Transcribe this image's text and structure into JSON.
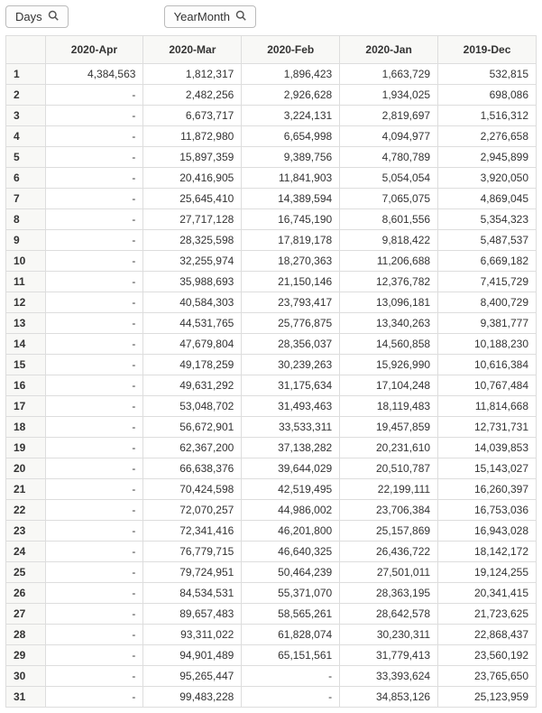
{
  "pills": {
    "days_label": "Days",
    "yearmonth_label": "YearMonth"
  },
  "table": {
    "columns": [
      "2020-Apr",
      "2020-Mar",
      "2020-Feb",
      "2020-Jan",
      "2019-Dec"
    ],
    "rows": [
      {
        "day": "1",
        "cells": [
          "4,384,563",
          "1,812,317",
          "1,896,423",
          "1,663,729",
          "532,815"
        ]
      },
      {
        "day": "2",
        "cells": [
          "-",
          "2,482,256",
          "2,926,628",
          "1,934,025",
          "698,086"
        ]
      },
      {
        "day": "3",
        "cells": [
          "-",
          "6,673,717",
          "3,224,131",
          "2,819,697",
          "1,516,312"
        ]
      },
      {
        "day": "4",
        "cells": [
          "-",
          "11,872,980",
          "6,654,998",
          "4,094,977",
          "2,276,658"
        ]
      },
      {
        "day": "5",
        "cells": [
          "-",
          "15,897,359",
          "9,389,756",
          "4,780,789",
          "2,945,899"
        ]
      },
      {
        "day": "6",
        "cells": [
          "-",
          "20,416,905",
          "11,841,903",
          "5,054,054",
          "3,920,050"
        ]
      },
      {
        "day": "7",
        "cells": [
          "-",
          "25,645,410",
          "14,389,594",
          "7,065,075",
          "4,869,045"
        ]
      },
      {
        "day": "8",
        "cells": [
          "-",
          "27,717,128",
          "16,745,190",
          "8,601,556",
          "5,354,323"
        ]
      },
      {
        "day": "9",
        "cells": [
          "-",
          "28,325,598",
          "17,819,178",
          "9,818,422",
          "5,487,537"
        ]
      },
      {
        "day": "10",
        "cells": [
          "-",
          "32,255,974",
          "18,270,363",
          "11,206,688",
          "6,669,182"
        ]
      },
      {
        "day": "11",
        "cells": [
          "-",
          "35,988,693",
          "21,150,146",
          "12,376,782",
          "7,415,729"
        ]
      },
      {
        "day": "12",
        "cells": [
          "-",
          "40,584,303",
          "23,793,417",
          "13,096,181",
          "8,400,729"
        ]
      },
      {
        "day": "13",
        "cells": [
          "-",
          "44,531,765",
          "25,776,875",
          "13,340,263",
          "9,381,777"
        ]
      },
      {
        "day": "14",
        "cells": [
          "-",
          "47,679,804",
          "28,356,037",
          "14,560,858",
          "10,188,230"
        ]
      },
      {
        "day": "15",
        "cells": [
          "-",
          "49,178,259",
          "30,239,263",
          "15,926,990",
          "10,616,384"
        ]
      },
      {
        "day": "16",
        "cells": [
          "-",
          "49,631,292",
          "31,175,634",
          "17,104,248",
          "10,767,484"
        ]
      },
      {
        "day": "17",
        "cells": [
          "-",
          "53,048,702",
          "31,493,463",
          "18,119,483",
          "11,814,668"
        ]
      },
      {
        "day": "18",
        "cells": [
          "-",
          "56,672,901",
          "33,533,311",
          "19,457,859",
          "12,731,731"
        ]
      },
      {
        "day": "19",
        "cells": [
          "-",
          "62,367,200",
          "37,138,282",
          "20,231,610",
          "14,039,853"
        ]
      },
      {
        "day": "20",
        "cells": [
          "-",
          "66,638,376",
          "39,644,029",
          "20,510,787",
          "15,143,027"
        ]
      },
      {
        "day": "21",
        "cells": [
          "-",
          "70,424,598",
          "42,519,495",
          "22,199,111",
          "16,260,397"
        ]
      },
      {
        "day": "22",
        "cells": [
          "-",
          "72,070,257",
          "44,986,002",
          "23,706,384",
          "16,753,036"
        ]
      },
      {
        "day": "23",
        "cells": [
          "-",
          "72,341,416",
          "46,201,800",
          "25,157,869",
          "16,943,028"
        ]
      },
      {
        "day": "24",
        "cells": [
          "-",
          "76,779,715",
          "46,640,325",
          "26,436,722",
          "18,142,172"
        ]
      },
      {
        "day": "25",
        "cells": [
          "-",
          "79,724,951",
          "50,464,239",
          "27,501,011",
          "19,124,255"
        ]
      },
      {
        "day": "26",
        "cells": [
          "-",
          "84,534,531",
          "55,371,070",
          "28,363,195",
          "20,341,415"
        ]
      },
      {
        "day": "27",
        "cells": [
          "-",
          "89,657,483",
          "58,565,261",
          "28,642,578",
          "21,723,625"
        ]
      },
      {
        "day": "28",
        "cells": [
          "-",
          "93,311,022",
          "61,828,074",
          "30,230,311",
          "22,868,437"
        ]
      },
      {
        "day": "29",
        "cells": [
          "-",
          "94,901,489",
          "65,151,561",
          "31,779,413",
          "23,560,192"
        ]
      },
      {
        "day": "30",
        "cells": [
          "-",
          "95,265,447",
          "-",
          "33,393,624",
          "23,765,650"
        ]
      },
      {
        "day": "31",
        "cells": [
          "-",
          "99,483,228",
          "-",
          "34,853,126",
          "25,123,959"
        ]
      }
    ]
  }
}
